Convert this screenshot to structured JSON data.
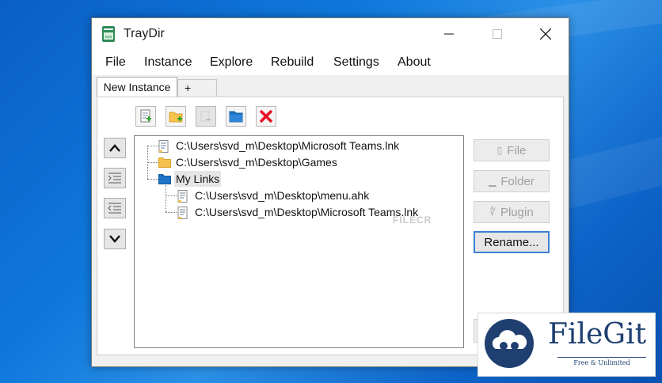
{
  "window": {
    "title": "TrayDir"
  },
  "menu": [
    "File",
    "Instance",
    "Explore",
    "Rebuild",
    "Settings",
    "About"
  ],
  "tabs": {
    "active": "New Instance",
    "add": "+"
  },
  "toolbar": {
    "icons": [
      "add-file-icon",
      "add-folder-icon",
      "add-plugin-icon",
      "blue-folder-icon",
      "delete-icon"
    ],
    "delete_color": "#e81123"
  },
  "side_controls": [
    "move-up-icon",
    "indent-icon",
    "outdent-icon",
    "move-down-icon"
  ],
  "tree": {
    "items": [
      {
        "label": "C:\\Users\\svd_m\\Desktop\\Microsoft Teams.lnk",
        "type": "file",
        "level": 0
      },
      {
        "label": "C:\\Users\\svd_m\\Desktop\\Games",
        "type": "folder",
        "level": 0
      },
      {
        "label": "My Links",
        "type": "virtual-folder",
        "level": 0,
        "selected": true
      },
      {
        "label": "C:\\Users\\svd_m\\Desktop\\menu.ahk",
        "type": "file",
        "level": 1
      },
      {
        "label": "C:\\Users\\svd_m\\Desktop\\Microsoft Teams.lnk",
        "type": "file",
        "level": 1
      }
    ]
  },
  "buttons": {
    "file": "File",
    "folder": "Folder",
    "plugin": "Plugin",
    "rename": "Rename..."
  },
  "watermark": "FILECR",
  "brand": {
    "name": "FileGit",
    "tagline": "Free & Unlimited",
    "color": "#1e3f70"
  },
  "colors": {
    "accent": "#3c7fd6",
    "folder": "#f6c24e",
    "blue_folder": "#1f73c6"
  }
}
